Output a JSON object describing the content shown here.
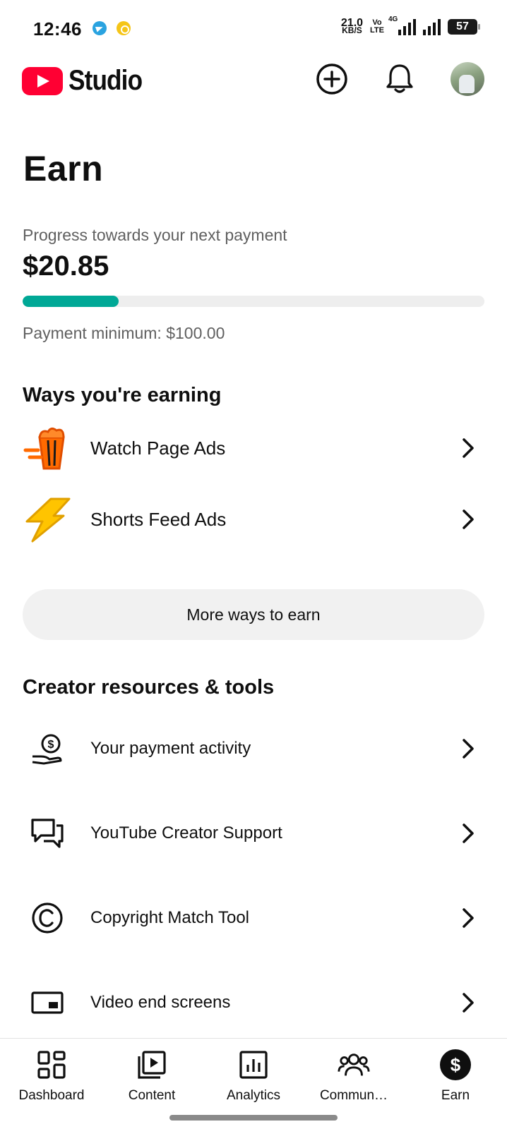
{
  "status_bar": {
    "time": "12:46",
    "net_speed": "21.0",
    "net_unit": "KB/S",
    "volte_top": "Vo",
    "volte_bottom": "LTE",
    "network_type": "4G",
    "battery": "57"
  },
  "header": {
    "app_name": "Studio",
    "brand_color": "#ff0033",
    "create_icon": "plus-circle-icon",
    "notifications_icon": "bell-icon"
  },
  "main": {
    "title": "Earn",
    "progress": {
      "label": "Progress towards your next payment",
      "amount": "$20.85",
      "fraction": 0.2085,
      "fill_color": "#00a896",
      "minimum": "Payment minimum: $100.00"
    },
    "ways_section": {
      "title": "Ways you're earning",
      "items": [
        {
          "label": "Watch Page Ads",
          "icon": "popcorn-icon"
        },
        {
          "label": "Shorts Feed Ads",
          "icon": "lightning-icon"
        }
      ],
      "more_button": "More ways to earn"
    },
    "tools_section": {
      "title": "Creator resources & tools",
      "items": [
        {
          "label": "Your payment activity",
          "icon": "payment-hand-icon"
        },
        {
          "label": "YouTube Creator Support",
          "icon": "chat-bubbles-icon"
        },
        {
          "label": "Copyright Match Tool",
          "icon": "copyright-icon"
        },
        {
          "label": "Video end screens",
          "icon": "end-screen-icon"
        }
      ]
    }
  },
  "bottom_nav": {
    "items": [
      {
        "label": "Dashboard",
        "icon": "dashboard-grid-icon"
      },
      {
        "label": "Content",
        "icon": "content-library-icon"
      },
      {
        "label": "Analytics",
        "icon": "analytics-chart-icon"
      },
      {
        "label": "Commun…",
        "icon": "community-people-icon"
      },
      {
        "label": "Earn",
        "icon": "dollar-circle-icon",
        "active": true
      }
    ]
  }
}
